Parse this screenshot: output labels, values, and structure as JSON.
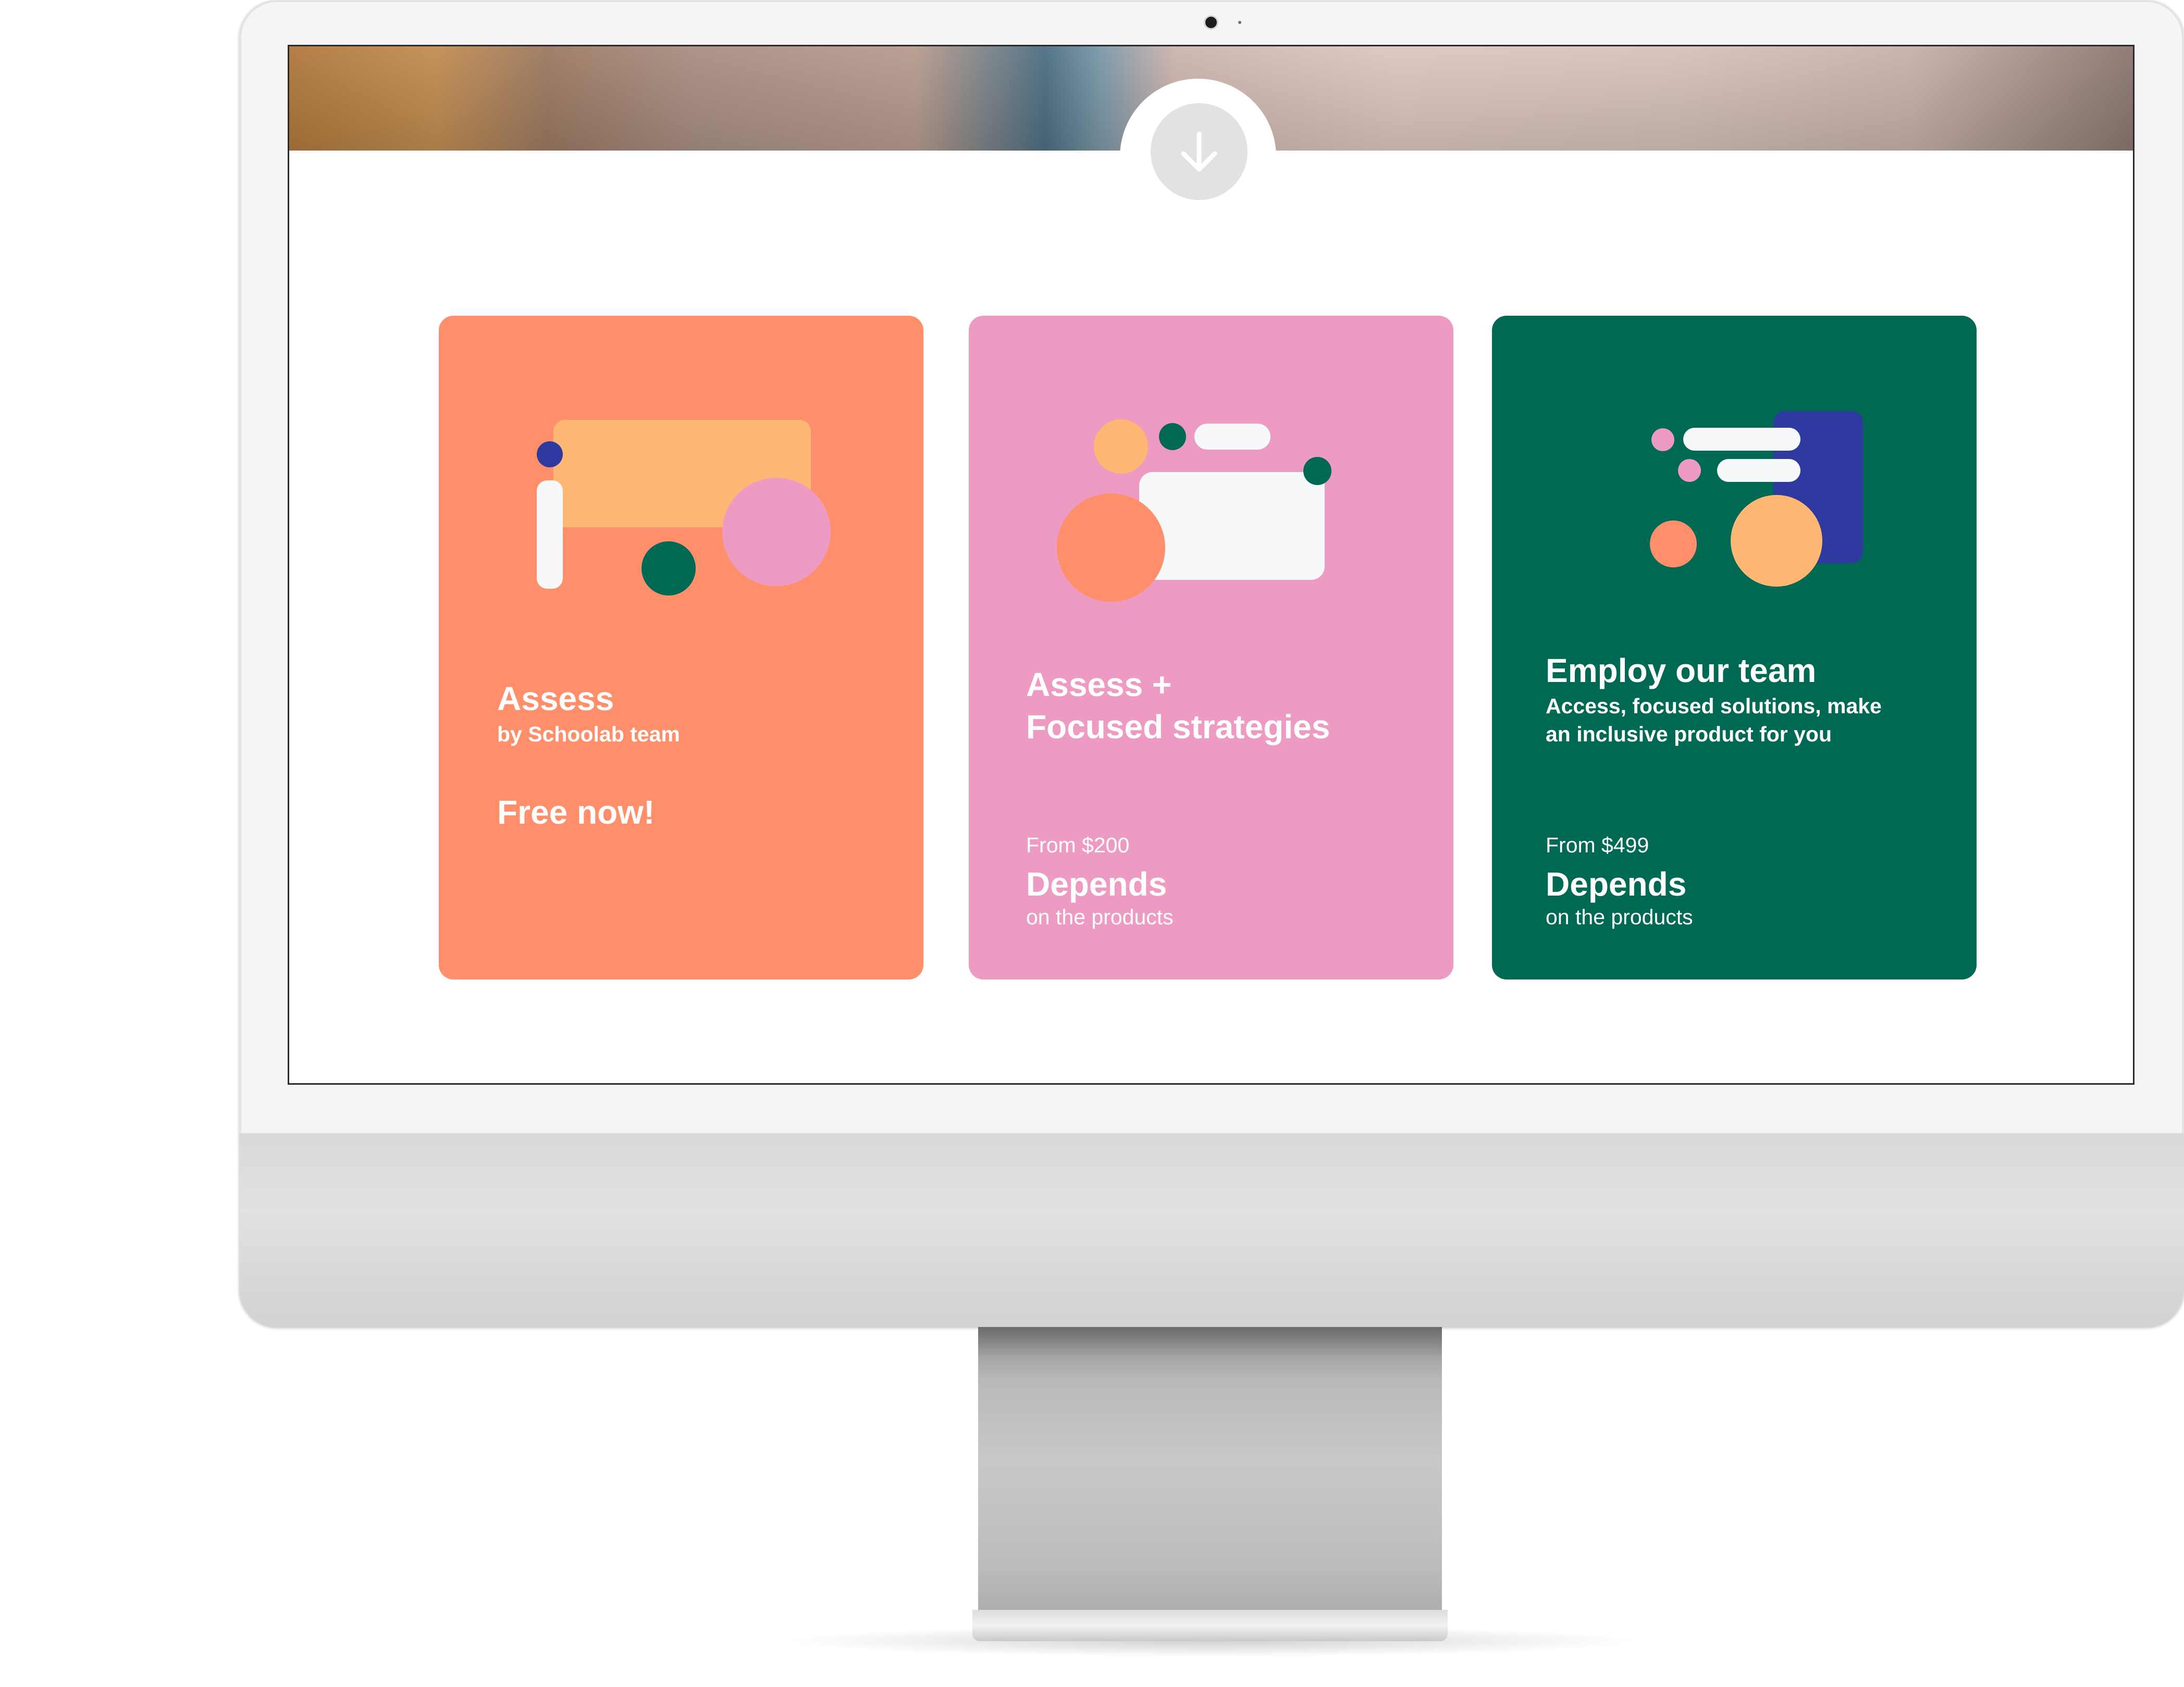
{
  "screen": {
    "scroll_icon": "arrow-down-icon"
  },
  "cards": [
    {
      "name": "Assess",
      "title": "Assess",
      "subtitle": "by Schoolab team",
      "highlight": "Free now!",
      "background": "#FF8F6B"
    },
    {
      "name": "Assess + Focused strategies",
      "title_line1": "Assess +",
      "title_line2": "Focused strategies",
      "price_from": "From $200",
      "price_main": "Depends",
      "price_note": "on the products",
      "background": "#EE9BC3"
    },
    {
      "name": "Employ our team",
      "title": "Employ our team",
      "subtitle_line1": "Access, focused solutions, make",
      "subtitle_line2": "an inclusive product for you",
      "price_from": "From $499",
      "price_main": "Depends",
      "price_note": "on the products",
      "background": "#006953"
    }
  ],
  "colors": {
    "orange": "#FF8F6B",
    "pink": "#EE9BC3",
    "green": "#006953",
    "peach": "#FFB873",
    "navy": "#2E3A9F",
    "off_white": "#F7F8FA"
  }
}
